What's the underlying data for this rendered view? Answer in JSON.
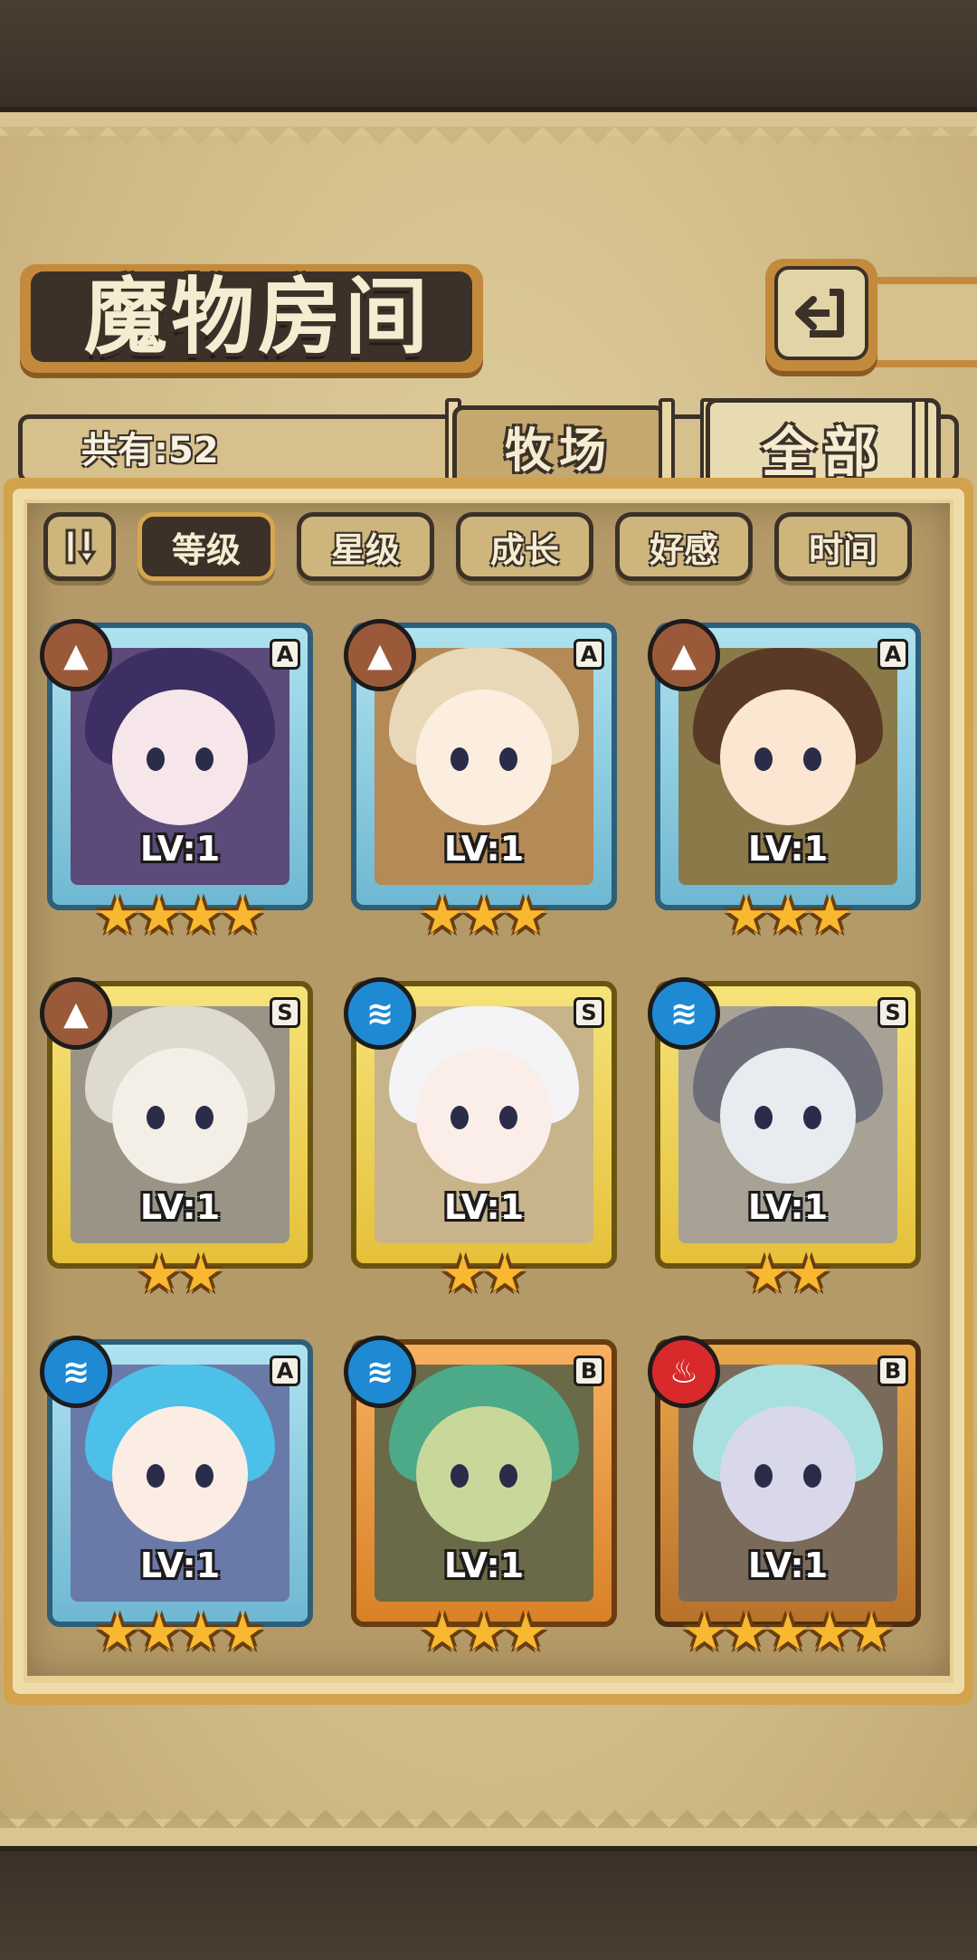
{
  "header": {
    "title": "魔物房间",
    "back_icon": "return-arrow-icon"
  },
  "summary": {
    "count_label": "共有:52"
  },
  "tabs": [
    {
      "label": "牧场",
      "active": false
    },
    {
      "label": "全部",
      "active": true
    }
  ],
  "filters": {
    "sort_icon": "sort-order-icon",
    "items": [
      {
        "label": "等级",
        "active": true
      },
      {
        "label": "星级",
        "active": false
      },
      {
        "label": "成长",
        "active": false
      },
      {
        "label": "好感",
        "active": false
      },
      {
        "label": "时间",
        "active": false
      }
    ]
  },
  "monsters": [
    {
      "rank": "A",
      "element": "earth",
      "level": "LV:1",
      "stars": 4,
      "frame": "blue"
    },
    {
      "rank": "A",
      "element": "earth",
      "level": "LV:1",
      "stars": 3,
      "frame": "blue"
    },
    {
      "rank": "A",
      "element": "earth",
      "level": "LV:1",
      "stars": 3,
      "frame": "blue"
    },
    {
      "rank": "S",
      "element": "earth",
      "level": "LV:1",
      "stars": 2,
      "frame": "gold"
    },
    {
      "rank": "S",
      "element": "water",
      "level": "LV:1",
      "stars": 2,
      "frame": "gold"
    },
    {
      "rank": "S",
      "element": "water",
      "level": "LV:1",
      "stars": 2,
      "frame": "gold"
    },
    {
      "rank": "A",
      "element": "water",
      "level": "LV:1",
      "stars": 4,
      "frame": "blue"
    },
    {
      "rank": "B",
      "element": "water",
      "level": "LV:1",
      "stars": 3,
      "frame": "orange"
    },
    {
      "rank": "B",
      "element": "fire",
      "level": "LV:1",
      "stars": 5,
      "frame": "bronze"
    }
  ],
  "colors": {
    "parchment": "#d9c492",
    "frame_gold": "#d3a24d",
    "outline": "#3b3128",
    "star": "#f8b830",
    "earth": "#9a5a3a",
    "water": "#1f8ad4",
    "fire": "#d82a2a"
  }
}
